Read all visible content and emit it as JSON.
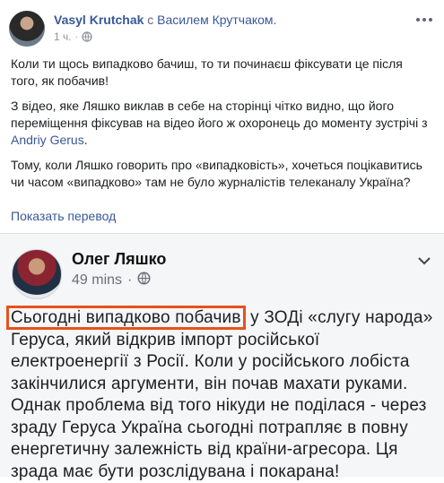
{
  "post": {
    "author": "Vasyl Krutchak",
    "with_word": "с",
    "tagged": "Василем Крутчаком.",
    "time": "1 ч.",
    "dot": "·",
    "paragraphs": {
      "p1": "Коли ти щось випадково бачиш, то ти починаєш фіксувати це після того, як побачив!",
      "p2_before": "З відео, яке Ляшко виклав в себе на сторінці чітко видно, що його переміщення фіксував на відео його ж охоронець до моменту зустрічі з ",
      "p2_link": "Andriy Gerus",
      "p2_after": ".",
      "p3": "Тому, коли Ляшко говорить про «випадковість», хочеться поцікавитись чи часом «випадково» там не було журналістів телеканалу Україна?"
    },
    "translate": "Показать перевод"
  },
  "embed": {
    "author": "Олег Ляшко",
    "time": "49 mins",
    "dot": "·",
    "highlight": "Сьогодні випадково побачив",
    "text_rest": " у ЗОДі «слугу народа» Геруса, який відкрив імпорт російської електроенергії з Росії. Коли у російського лобіста закінчилися аргументи, він почав махати руками. Однак проблема від того нікуди не поділася - через зраду Геруса Україна сьогодні потрапляє в повну енергетичну залежність від країни-агресора. Ця зрада має бути розслідувана і покарана!"
  },
  "icons": {
    "globe": "globe-icon",
    "more": "more-options-icon",
    "chevron": "chevron-down-icon"
  },
  "colors": {
    "link": "#385898",
    "highlight_border": "#e8501c",
    "embed_bg": "#f5f6f7"
  }
}
